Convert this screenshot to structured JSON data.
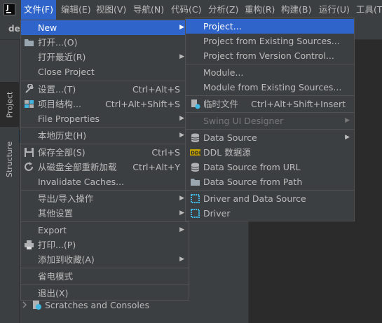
{
  "menubar": {
    "items": [
      {
        "label": "文件(F)",
        "active": true
      },
      {
        "label": "编辑(E)"
      },
      {
        "label": "视图(V)"
      },
      {
        "label": "导航(N)"
      },
      {
        "label": "代码(C)"
      },
      {
        "label": "分析(Z)"
      },
      {
        "label": "重构(R)"
      },
      {
        "label": "构建(B)"
      },
      {
        "label": "运行(U)"
      },
      {
        "label": "工具(T"
      }
    ]
  },
  "toolbar": {
    "project_name": "der"
  },
  "tool_window_tabs": {
    "project": "Project",
    "structure": "Structure"
  },
  "project_panel": {
    "scratches_label": "Scratches and Consoles"
  },
  "file_menu": {
    "items": [
      {
        "label": "New",
        "shortcut": "",
        "arrow": "▶",
        "icon": ""
      },
      {
        "label": "打开...(O)",
        "shortcut": "",
        "arrow": "",
        "icon": "folder-open-icon"
      },
      {
        "label": "打开最近(R)",
        "shortcut": "",
        "arrow": "▶",
        "icon": ""
      },
      {
        "label": "Close Project",
        "shortcut": "",
        "arrow": "",
        "icon": ""
      },
      {
        "label": "设置...(T)",
        "shortcut": "Ctrl+Alt+S",
        "arrow": "",
        "icon": "wrench-icon"
      },
      {
        "label": "项目结构...",
        "shortcut": "Ctrl+Alt+Shift+S",
        "arrow": "",
        "icon": "project-structure-icon"
      },
      {
        "label": "File Properties",
        "shortcut": "",
        "arrow": "▶",
        "icon": ""
      },
      {
        "label": "本地历史(H)",
        "shortcut": "",
        "arrow": "▶",
        "icon": ""
      },
      {
        "label": "保存全部(S)",
        "shortcut": "Ctrl+S",
        "arrow": "",
        "icon": "save-icon"
      },
      {
        "label": "从磁盘全部重新加载",
        "shortcut": "Ctrl+Alt+Y",
        "arrow": "",
        "icon": "reload-icon"
      },
      {
        "label": "Invalidate Caches...",
        "shortcut": "",
        "arrow": "",
        "icon": ""
      },
      {
        "label": "导出/导入操作",
        "shortcut": "",
        "arrow": "▶",
        "icon": ""
      },
      {
        "label": "其他设置",
        "shortcut": "",
        "arrow": "▶",
        "icon": ""
      },
      {
        "label": "Export",
        "shortcut": "",
        "arrow": "▶",
        "icon": ""
      },
      {
        "label": "打印...(P)",
        "shortcut": "",
        "arrow": "",
        "icon": "print-icon"
      },
      {
        "label": "添加到收藏(A)",
        "shortcut": "",
        "arrow": "▶",
        "icon": ""
      },
      {
        "label": "省电模式",
        "shortcut": "",
        "arrow": "",
        "icon": ""
      },
      {
        "label": "退出(X)",
        "shortcut": "",
        "arrow": "",
        "icon": ""
      }
    ]
  },
  "new_submenu": {
    "items": [
      {
        "label": "Project...",
        "shortcut": "",
        "arrow": "",
        "icon": ""
      },
      {
        "label": "Project from Existing Sources...",
        "shortcut": "",
        "arrow": "",
        "icon": ""
      },
      {
        "label": "Project from Version Control...",
        "shortcut": "",
        "arrow": "",
        "icon": ""
      },
      {
        "label": "Module...",
        "shortcut": "",
        "arrow": "",
        "icon": ""
      },
      {
        "label": "Module from Existing Sources...",
        "shortcut": "",
        "arrow": "",
        "icon": ""
      },
      {
        "label": "临时文件",
        "shortcut": "Ctrl+Alt+Shift+Insert",
        "arrow": "",
        "icon": "scratch-file-icon"
      },
      {
        "label": "Swing UI Designer",
        "shortcut": "",
        "arrow": "▶",
        "icon": "",
        "disabled": true
      },
      {
        "label": "Data Source",
        "shortcut": "",
        "arrow": "▶",
        "icon": "database-icon"
      },
      {
        "label": "DDL 数据源",
        "shortcut": "",
        "arrow": "",
        "icon": "ddl-icon"
      },
      {
        "label": "Data Source from URL",
        "shortcut": "",
        "arrow": "",
        "icon": "database-icon"
      },
      {
        "label": "Data Source from Path",
        "shortcut": "",
        "arrow": "",
        "icon": "folder-icon"
      },
      {
        "label": "Driver and Data Source",
        "shortcut": "",
        "arrow": "",
        "icon": "driver-icon"
      },
      {
        "label": "Driver",
        "shortcut": "",
        "arrow": "",
        "icon": "driver-icon"
      }
    ]
  },
  "colors": {
    "menu_bg": "#3c3f41",
    "highlight": "#2f65ca",
    "text": "#bbbbbb",
    "disabled_text": "#777777"
  }
}
